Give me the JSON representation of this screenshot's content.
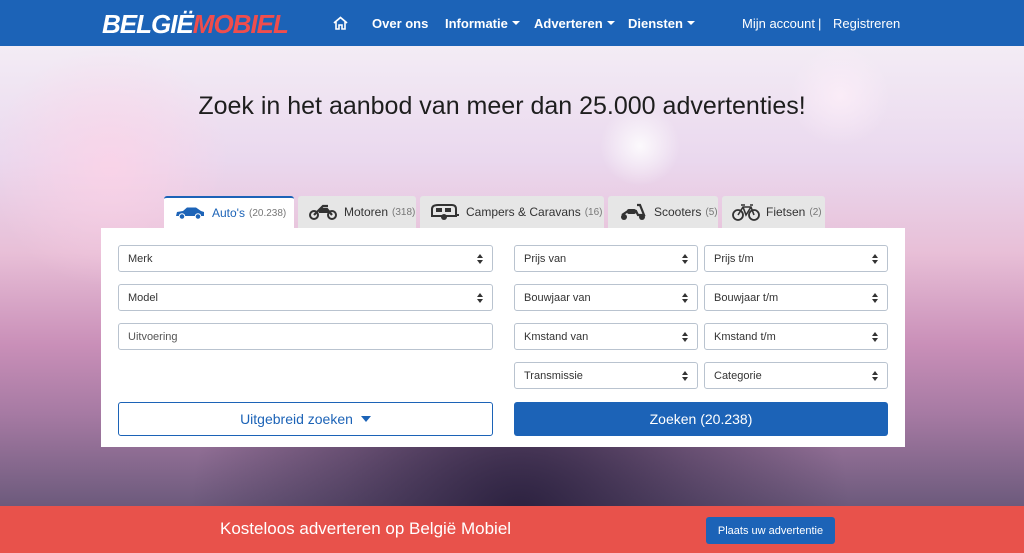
{
  "header": {
    "logo_part1": "BELGIË",
    "logo_part2": "MOBIEL",
    "nav": {
      "home_icon": "home-icon",
      "over_ons": "Over ons",
      "informatie": "Informatie",
      "adverteren": "Adverteren",
      "diensten": "Diensten",
      "account": "Mijn account",
      "separator": "|",
      "registreren": "Registreren"
    }
  },
  "hero": {
    "title": "Zoek in het aanbod van meer dan 25.000 advertenties!"
  },
  "tabs": [
    {
      "label": "Auto's",
      "count": "(20.238)",
      "icon": "car-icon"
    },
    {
      "label": "Motoren",
      "count": "(318)",
      "icon": "motorcycle-icon"
    },
    {
      "label": "Campers & Caravans",
      "count": "(16)",
      "icon": "caravan-icon"
    },
    {
      "label": "Scooters",
      "count": "(5)",
      "icon": "scooter-icon"
    },
    {
      "label": "Fietsen",
      "count": "(2)",
      "icon": "bicycle-icon"
    }
  ],
  "search": {
    "merk": "Merk",
    "model": "Model",
    "uitvoering_placeholder": "Uitvoering",
    "prijs_van": "Prijs van",
    "prijs_tm": "Prijs t/m",
    "bouwjaar_van": "Bouwjaar van",
    "bouwjaar_tm": "Bouwjaar t/m",
    "kmstand_van": "Kmstand van",
    "kmstand_tm": "Kmstand t/m",
    "transmissie": "Transmissie",
    "categorie": "Categorie",
    "advanced_label": "Uitgebreid zoeken",
    "search_label": "Zoeken (20.238)"
  },
  "footer": {
    "text": "Kosteloos adverteren op België Mobiel",
    "button": "Plaats uw advertentie"
  },
  "colors": {
    "primary": "#1c63b7",
    "accent": "#e8524b"
  }
}
